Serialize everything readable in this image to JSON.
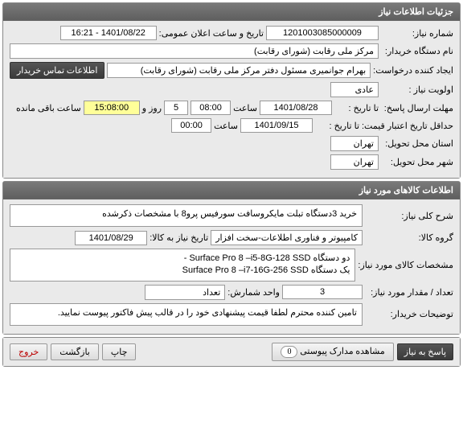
{
  "section1": {
    "title": "جزئیات اطلاعات نیاز",
    "num_label": "شماره نیاز:",
    "num_value": "1201003085000009",
    "announce_label": "تاریخ و ساعت اعلان عمومی:",
    "announce_value": "1401/08/22 - 16:21",
    "buyer_label": "نام دستگاه خریدار:",
    "buyer_value": "مرکز ملی رقابت (شورای رقابت)",
    "creator_label": "ایجاد کننده درخواست:",
    "creator_value": "بهرام جوانمیری مسئول دفتر مرکز ملی رقابت (شورای رقابت)",
    "contact_btn": "اطلاعات تماس خریدار",
    "priority_label": "اولویت نیاز :",
    "priority_value": "عادی",
    "deadline_label": "مهلت ارسال پاسخ:",
    "deadline_to": "تا تاریخ :",
    "deadline_date": "1401/08/28",
    "deadline_time_label": "ساعت",
    "deadline_time": "08:00",
    "days_count": "5",
    "days_and": "روز و",
    "remain_time": "15:08:00",
    "remain_text": "ساعت باقی مانده",
    "min_validity_label": "حداقل تاریخ اعتبار قیمت:",
    "min_validity_to": "تا تاریخ :",
    "min_validity_date": "1401/09/15",
    "min_validity_time_label": "ساعت",
    "min_validity_time": "00:00",
    "province_label": "استان محل تحویل:",
    "province_value": "تهران",
    "city_label": "شهر محل تحویل:",
    "city_value": "تهران"
  },
  "section2": {
    "title": "اطلاعات کالاهای مورد نیاز",
    "desc_label": "شرح کلی نیاز:",
    "desc_value": "خرید 3دستگاه تبلت مایکروسافت سورفیس پرو8 با مشخصات ذکرشده",
    "group_label": "گروه کالا:",
    "group_value": "کامپیوتر و فناوری اطلاعات-سخت افزار",
    "need_date_label": "تاریخ نیاز به کالا:",
    "need_date_value": "1401/08/29",
    "spec_label": "مشخصات کالای مورد نیاز:",
    "spec_value": "دو دستگاه Surface Pro 8 –i5-8G-128 SSD -\nیک دستگاه Surface Pro 8 –i7-16G-256 SSD",
    "qty_label": "تعداد / مقدار مورد نیاز:",
    "qty_value": "3",
    "unit_label": "واحد شمارش:",
    "unit_value": "تعداد",
    "note_label": "توضیحات خریدار:",
    "note_value": "تامین کننده محترم لطفا قیمت پیشنهادی خود را در قالب پیش فاکتور پیوست نمایید."
  },
  "footer": {
    "reply": "پاسخ به نیاز",
    "attach": "مشاهده مدارک پیوستی",
    "attach_count": "0",
    "print": "چاپ",
    "back": "بازگشت",
    "exit": "خروج"
  }
}
